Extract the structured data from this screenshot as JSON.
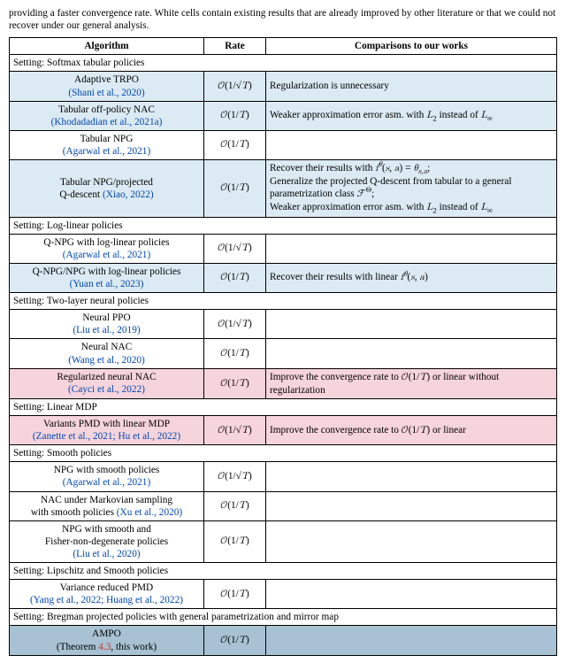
{
  "caption": "providing a faster convergence rate. White cells contain existing results that are already improved by other literature or that we could not recover under our general analysis.",
  "head": {
    "alg": "Algorithm",
    "rate": "Rate",
    "cmp": "Comparisons to our works"
  },
  "rate": {
    "sqrtT": "𝒪(1/√T)",
    "T": "𝒪(1/T)"
  },
  "s1": {
    "label": "Setting: Softmax tabular policies"
  },
  "r1_1": {
    "name": "Adaptive TRPO",
    "cite": "(Shani et al., 2020)",
    "cmp": "Regularization is unnecessary"
  },
  "r1_2": {
    "name": "Tabular off-policy NAC",
    "cite": "(Khodadadian et al., 2021a)",
    "cmp": "Weaker approximation error asm. with L₂ instead of L∞"
  },
  "r1_3": {
    "name": "Tabular NPG",
    "cite": "(Agarwal et al., 2021)"
  },
  "r1_4": {
    "name": "Tabular NPG/projected",
    "name2": "Q-descent",
    "cite": "(Xiao, 2022)",
    "cmp1": "Recover their results with f θ(s, a) = θs,a;",
    "cmp2": "Generalize the projected Q-descent from tabular to a general parametrization class ℱ Θ;",
    "cmp3": "Weaker approximation error asm. with L₂ instead of L∞"
  },
  "s2": {
    "label": "Setting: Log-linear policies"
  },
  "r2_1": {
    "name": "Q-NPG with log-linear policies",
    "cite": "(Agarwal et al., 2021)"
  },
  "r2_2": {
    "name": "Q-NPG/NPG with log-linear policies",
    "cite": "(Yuan et al., 2023)",
    "cmp": "Recover their results with linear f θ(s, a)"
  },
  "s3": {
    "label": "Setting: Two-layer neural policies"
  },
  "r3_1": {
    "name": "Neural PPO",
    "cite": "(Liu et al., 2019)"
  },
  "r3_2": {
    "name": "Neural NAC",
    "cite": "(Wang et al., 2020)"
  },
  "r3_3": {
    "name": "Regularized neural NAC",
    "cite": "(Cayci et al., 2022)",
    "cmp": "Improve the convergence rate to 𝒪(1/T) or linear without regularization"
  },
  "s4": {
    "label": "Setting: Linear MDP"
  },
  "r4_1": {
    "name": "Variants PMD with linear MDP",
    "cite": "(Zanette et al., 2021; Hu et al., 2022)",
    "cmp": "Improve the convergence rate to 𝒪(1/T) or linear"
  },
  "s5": {
    "label": "Setting: Smooth policies"
  },
  "r5_1": {
    "name": "NPG with smooth policies",
    "cite": "(Agarwal et al., 2021)"
  },
  "r5_2": {
    "name1": "NAC under Markovian sampling",
    "name2": "with smooth policies",
    "cite": "(Xu et al., 2020)"
  },
  "r5_3": {
    "name1": "NPG with smooth and",
    "name2": "Fisher-non-degenerate policies",
    "cite": "(Liu et al., 2020)"
  },
  "s6": {
    "label": "Setting: Lipschitz and Smooth policies"
  },
  "r6_1": {
    "name": "Variance reduced PMD",
    "cite": "(Yang et al., 2022; Huang et al., 2022)"
  },
  "s7": {
    "label": "Setting: Bregman projected policies with general parametrization and mirror map"
  },
  "r7_1": {
    "name": "AMPO",
    "thm": "(Theorem 4.3, this work)"
  }
}
